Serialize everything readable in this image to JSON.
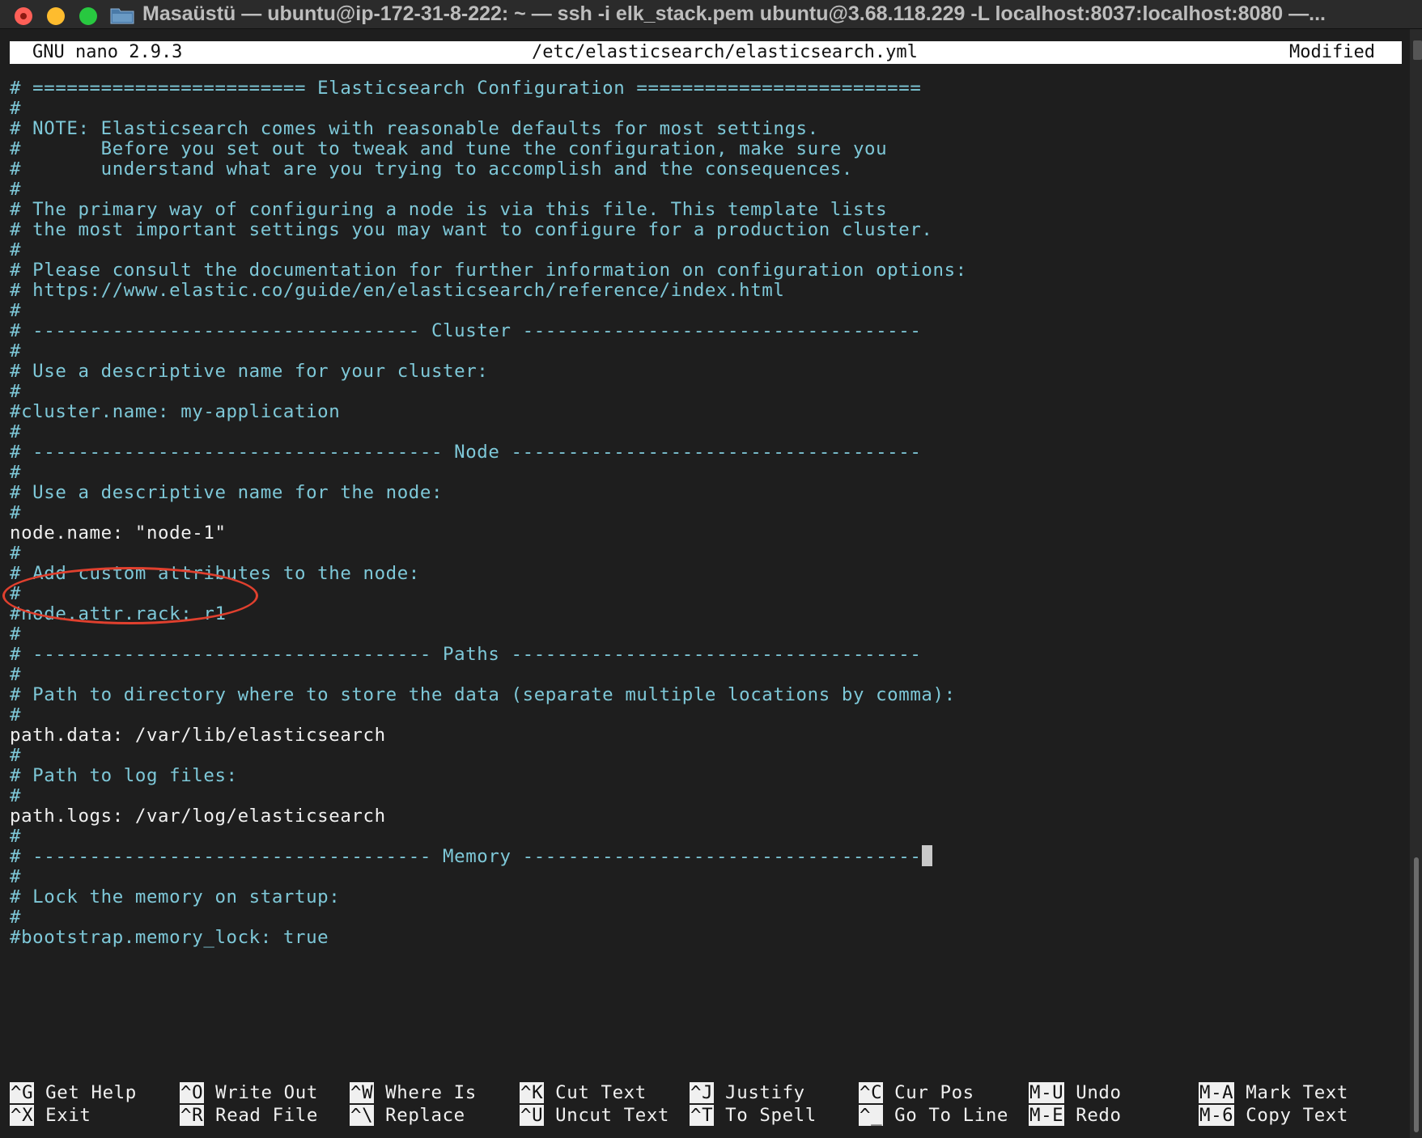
{
  "window": {
    "title": "Masaüstü — ubuntu@ip-172-31-8-222: ~ — ssh -i elk_stack.pem ubuntu@3.68.118.229 -L localhost:8037:localhost:8080 —..."
  },
  "nano": {
    "version": "GNU nano 2.9.3",
    "filename": "/etc/elasticsearch/elasticsearch.yml",
    "status": "Modified"
  },
  "lines": [
    {
      "text": "# ======================== Elasticsearch Configuration =========================",
      "kind": "comment"
    },
    {
      "text": "#",
      "kind": "comment"
    },
    {
      "text": "# NOTE: Elasticsearch comes with reasonable defaults for most settings.",
      "kind": "comment"
    },
    {
      "text": "#       Before you set out to tweak and tune the configuration, make sure you",
      "kind": "comment"
    },
    {
      "text": "#       understand what are you trying to accomplish and the consequences.",
      "kind": "comment"
    },
    {
      "text": "#",
      "kind": "comment"
    },
    {
      "text": "# The primary way of configuring a node is via this file. This template lists",
      "kind": "comment"
    },
    {
      "text": "# the most important settings you may want to configure for a production cluster.",
      "kind": "comment"
    },
    {
      "text": "#",
      "kind": "comment"
    },
    {
      "text": "# Please consult the documentation for further information on configuration options:",
      "kind": "comment"
    },
    {
      "text": "# https://www.elastic.co/guide/en/elasticsearch/reference/index.html",
      "kind": "comment"
    },
    {
      "text": "#",
      "kind": "comment"
    },
    {
      "text": "# ---------------------------------- Cluster -----------------------------------",
      "kind": "comment"
    },
    {
      "text": "#",
      "kind": "comment"
    },
    {
      "text": "# Use a descriptive name for your cluster:",
      "kind": "comment"
    },
    {
      "text": "#",
      "kind": "comment"
    },
    {
      "text": "#cluster.name: my-application",
      "kind": "comment"
    },
    {
      "text": "#",
      "kind": "comment"
    },
    {
      "text": "# ------------------------------------ Node ------------------------------------",
      "kind": "comment"
    },
    {
      "text": "#",
      "kind": "comment"
    },
    {
      "text": "# Use a descriptive name for the node:",
      "kind": "comment"
    },
    {
      "text": "#",
      "kind": "comment"
    },
    {
      "text": "node.name: \"node-1\"",
      "kind": "code"
    },
    {
      "text": "#",
      "kind": "comment"
    },
    {
      "text": "# Add custom attributes to the node:",
      "kind": "comment"
    },
    {
      "text": "#",
      "kind": "comment"
    },
    {
      "text": "#node.attr.rack: r1",
      "kind": "comment"
    },
    {
      "text": "#",
      "kind": "comment"
    },
    {
      "text": "# ----------------------------------- Paths ------------------------------------",
      "kind": "comment"
    },
    {
      "text": "#",
      "kind": "comment"
    },
    {
      "text": "# Path to directory where to store the data (separate multiple locations by comma):",
      "kind": "comment"
    },
    {
      "text": "#",
      "kind": "comment"
    },
    {
      "text": "path.data: /var/lib/elasticsearch",
      "kind": "code"
    },
    {
      "text": "#",
      "kind": "comment"
    },
    {
      "text": "# Path to log files:",
      "kind": "comment"
    },
    {
      "text": "#",
      "kind": "comment"
    },
    {
      "text": "path.logs: /var/log/elasticsearch",
      "kind": "code"
    },
    {
      "text": "#",
      "kind": "comment"
    },
    {
      "text": "# ----------------------------------- Memory -----------------------------------",
      "kind": "comment"
    },
    {
      "text": "#",
      "kind": "comment"
    },
    {
      "text": "# Lock the memory on startup:",
      "kind": "comment"
    },
    {
      "text": "#",
      "kind": "comment"
    },
    {
      "text": "#bootstrap.memory_lock: true",
      "kind": "comment"
    }
  ],
  "cursor_line": 38,
  "shortcuts": [
    {
      "key": "^G",
      "label": "Get Help"
    },
    {
      "key": "^X",
      "label": "Exit"
    },
    {
      "key": "^O",
      "label": "Write Out"
    },
    {
      "key": "^R",
      "label": "Read File"
    },
    {
      "key": "^W",
      "label": "Where Is"
    },
    {
      "key": "^\\",
      "label": "Replace"
    },
    {
      "key": "^K",
      "label": "Cut Text"
    },
    {
      "key": "^U",
      "label": "Uncut Text"
    },
    {
      "key": "^J",
      "label": "Justify"
    },
    {
      "key": "^T",
      "label": "To Spell"
    },
    {
      "key": "^C",
      "label": "Cur Pos"
    },
    {
      "key": "^_",
      "label": "Go To Line"
    },
    {
      "key": "M-U",
      "label": "Undo"
    },
    {
      "key": "M-E",
      "label": "Redo"
    },
    {
      "key": "M-A",
      "label": "Mark Text"
    },
    {
      "key": "M-6",
      "label": "Copy Text"
    }
  ],
  "colors": {
    "comment": "#7ec8d8",
    "code": "#f0f0f0",
    "background": "#1e1e1e",
    "annotation": "#e0402e"
  }
}
